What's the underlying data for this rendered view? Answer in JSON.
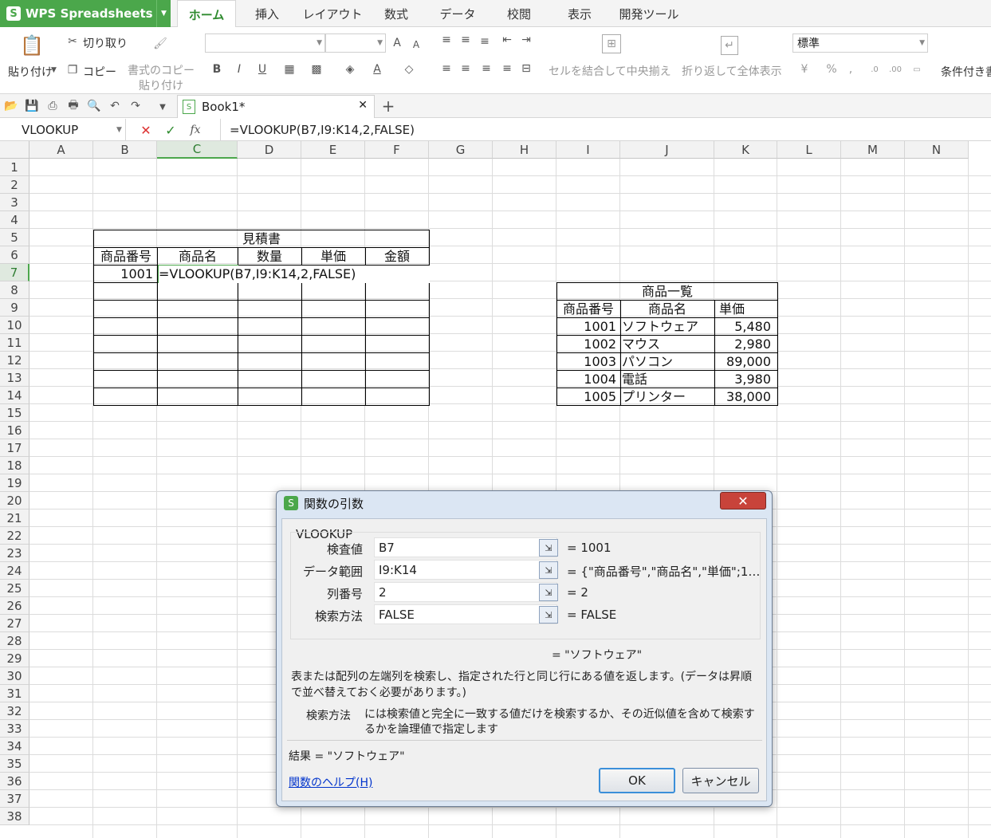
{
  "app": {
    "name": "WPS Spreadsheets"
  },
  "ribbon_tabs": [
    {
      "label": "ホーム"
    },
    {
      "label": "挿入"
    },
    {
      "label": "レイアウト"
    },
    {
      "label": "数式"
    },
    {
      "label": "データ"
    },
    {
      "label": "校閲"
    },
    {
      "label": "表示"
    },
    {
      "label": "開発ツール"
    }
  ],
  "ribbon": {
    "paste": "貼り付け",
    "cut": "切り取り",
    "copy": "コピー",
    "format_copy_1": "書式のコピー",
    "format_copy_2": "貼り付け",
    "merge_center": "セルを結合して中央揃え",
    "wrap_text": "折り返して全体表示",
    "number_format": "標準",
    "conditional": "条件付き書"
  },
  "document_tab": {
    "title": "Book1*"
  },
  "formula_bar": {
    "name_box": "VLOOKUP",
    "formula": "=VLOOKUP(B7,I9:K14,2,FALSE)"
  },
  "columns": [
    "A",
    "B",
    "C",
    "D",
    "E",
    "F",
    "G",
    "H",
    "I",
    "J",
    "K",
    "L",
    "M",
    "N"
  ],
  "rows": [
    "1",
    "2",
    "3",
    "4",
    "5",
    "6",
    "7",
    "8",
    "9",
    "10",
    "11",
    "12",
    "13",
    "14",
    "15",
    "16",
    "17",
    "18",
    "19",
    "20",
    "21",
    "22",
    "23",
    "24",
    "25",
    "26",
    "27",
    "28",
    "29",
    "30",
    "31",
    "32",
    "33",
    "34",
    "35",
    "36",
    "37",
    "38"
  ],
  "quote": {
    "title": "見積書",
    "headers": [
      "商品番号",
      "商品名",
      "数量",
      "単価",
      "金額"
    ],
    "row7_b": "1001",
    "row7_c": "=VLOOKUP(B7,I9:K14,2,FALSE)"
  },
  "catalog": {
    "title": "商品一覧",
    "headers": [
      "商品番号",
      "商品名",
      "単価"
    ],
    "rows": [
      {
        "id": "1001",
        "name": "ソフトウェア",
        "price": "5,480"
      },
      {
        "id": "1002",
        "name": "マウス",
        "price": "2,980"
      },
      {
        "id": "1003",
        "name": "パソコン",
        "price": "89,000"
      },
      {
        "id": "1004",
        "name": "電話",
        "price": "3,980"
      },
      {
        "id": "1005",
        "name": "プリンター",
        "price": "38,000"
      }
    ]
  },
  "dialog": {
    "title": "関数の引数",
    "function_name": "VLOOKUP",
    "args": [
      {
        "label": "検査値",
        "value": "B7",
        "result": "= 1001"
      },
      {
        "label": "データ範囲",
        "value": "I9:K14",
        "result": "= {\"商品番号\",\"商品名\",\"単価\";1…"
      },
      {
        "label": "列番号",
        "value": "2",
        "result": "= 2"
      },
      {
        "label": "検索方法",
        "value": "FALSE",
        "result": "= FALSE"
      }
    ],
    "formula_result": "= \"ソフトウェア\"",
    "description": "表または配列の左端列を検索し、指定された行と同じ行にある値を返します。(データは昇順で並べ替えておく必要があります。)",
    "arg_help_label": "検索方法",
    "arg_help": "には検索値と完全に一致する値だけを検索するか、その近似値を含めて検索するかを論理値で指定します",
    "result_line": "結果 = \"ソフトウェア\"",
    "help_link": "関数のヘルプ(H)",
    "ok": "OK",
    "cancel": "キャンセル"
  },
  "colors": {
    "accent": "#4ba74b",
    "link": "#0033cc",
    "close": "#c8433a"
  }
}
